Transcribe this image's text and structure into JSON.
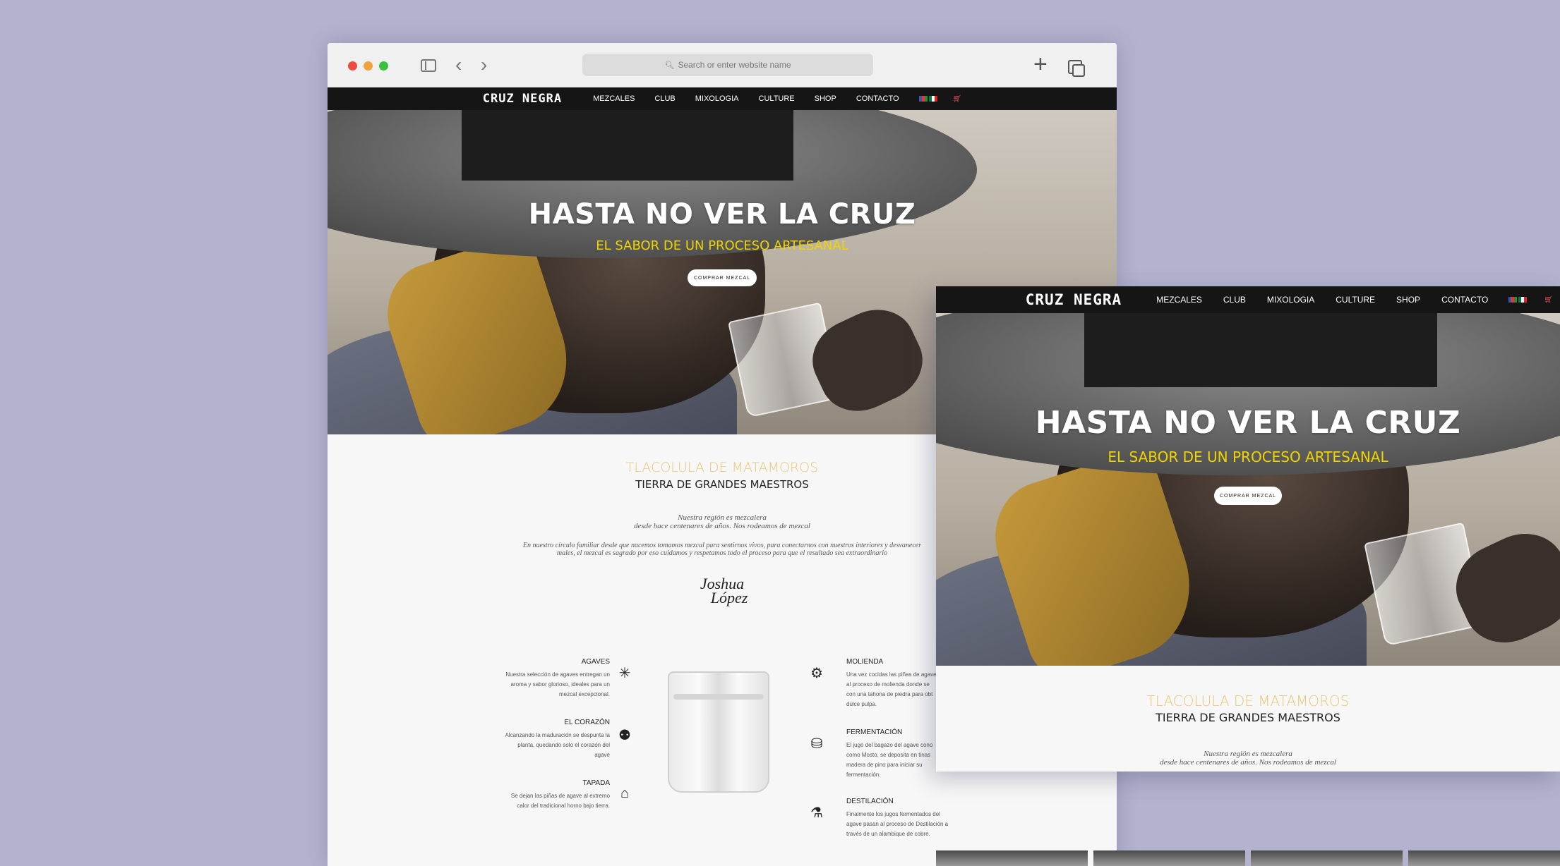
{
  "browser": {
    "address_placeholder": "Search or enter website name"
  },
  "site": {
    "logo": "CRUZ NEGRA",
    "nav": [
      "MEZCALES",
      "CLUB",
      "MIXOLOGIA",
      "CULTURE",
      "SHOP",
      "CONTACTO"
    ],
    "cart_count": "0"
  },
  "hero": {
    "title": "HASTA NO VER LA CRUZ",
    "subtitle": "EL SABOR DE UN PROCESO ARTESANAL",
    "cta": "COMPRAR MEZCAL"
  },
  "intro": {
    "region": "TLACOLULA DE MATAMOROS",
    "tagline": "TIERRA DE GRANDES MAESTROS",
    "quote_line1": "Nuestra región es mezcalera",
    "quote_line2": "desde hace centenares de años. Nos rodeamos de mezcal",
    "body_line1": "En nuestro círculo familiar desde que nacemos tomamos mezcal para sentirnos vivos, para conectarnos con nuestros interiores y desvanecer",
    "body_line2": "males, el mezcal es sagrado por eso cuidamos y respetamos todo el proceso para que el resultado sea extraordinario",
    "signature_line1": "Joshua",
    "signature_line2": "López"
  },
  "process_left": [
    {
      "title": "AGAVES",
      "text": [
        "Nuestra selección de agaves entregan un",
        "aroma y sabor glorioso, ideales para un",
        "mezcal excepcional."
      ],
      "icon": "agave-icon"
    },
    {
      "title": "EL CORAZÓN",
      "text": [
        "Alcanzando la maduración se despunta la",
        "planta, quedando solo el corazón del",
        "agave"
      ],
      "icon": "heart-of-agave-icon"
    },
    {
      "title": "TAPADA",
      "text": [
        "Se dejan las piñas de agave al extremo",
        "calor del tradicional horno bajo tierra."
      ],
      "icon": "oven-icon"
    }
  ],
  "process_right": [
    {
      "title": "MOLIENDA",
      "text": [
        "Una vez cocidas las piñas de agave",
        "al proceso de molienda donde se",
        "con una tahona de piedra para obt",
        "dulce pulpa."
      ],
      "icon": "mill-icon"
    },
    {
      "title": "FERMENTACIÓN",
      "text": [
        "El jugo del bagazo del agave cono",
        "como Mosto, se deposita en tinas",
        "madera de pino para iniciar su",
        "fermentación."
      ],
      "icon": "barrel-icon"
    },
    {
      "title": "DESTILACIÓN",
      "text": [
        "Finalmente los jugos fermentados del",
        "agave pasan al proceso de Destilación a",
        "través de un alambique de cobre."
      ],
      "icon": "still-icon"
    }
  ],
  "colors": {
    "background": "#b3b3cf",
    "nav_bg": "#151515",
    "gold": "#e7c873",
    "hero_subtitle": "#f0d400"
  }
}
